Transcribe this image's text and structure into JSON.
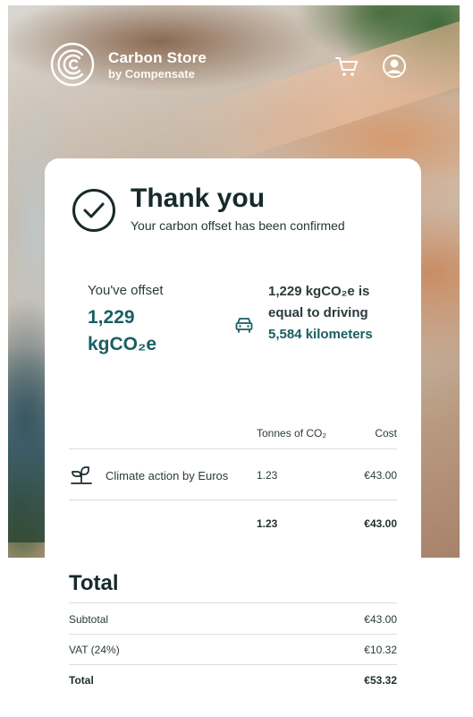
{
  "brand": {
    "title": "Carbon Store",
    "subtitle": "by Compensate"
  },
  "header": {
    "cart_icon": "cart-icon",
    "user_icon": "user-icon"
  },
  "confirmation": {
    "title": "Thank you",
    "subtitle": "Your carbon offset has been confirmed"
  },
  "offset": {
    "label": "You've offset",
    "value_line1": "1,229",
    "value_line2": "kgCO₂e",
    "equiv_prefix": "1,229 kgCO₂e is equal to driving",
    "equiv_value": "5,584 kilometers"
  },
  "table": {
    "col_tonnes": "Tonnes of CO₂",
    "col_cost": "Cost",
    "rows": [
      {
        "icon": "sprout-icon",
        "name": "Climate action by Euros",
        "tonnes": "1.23",
        "cost": "€43.00"
      }
    ],
    "sum_tonnes": "1.23",
    "sum_cost": "€43.00"
  },
  "totals": {
    "title": "Total",
    "subtotal_label": "Subtotal",
    "subtotal_value": "€43.00",
    "vat_label": "VAT (24%)",
    "vat_value": "€10.32",
    "total_label": "Total",
    "total_value": "€53.32"
  },
  "colors": {
    "accent": "#1a5e62",
    "text": "#1f2d2e"
  }
}
